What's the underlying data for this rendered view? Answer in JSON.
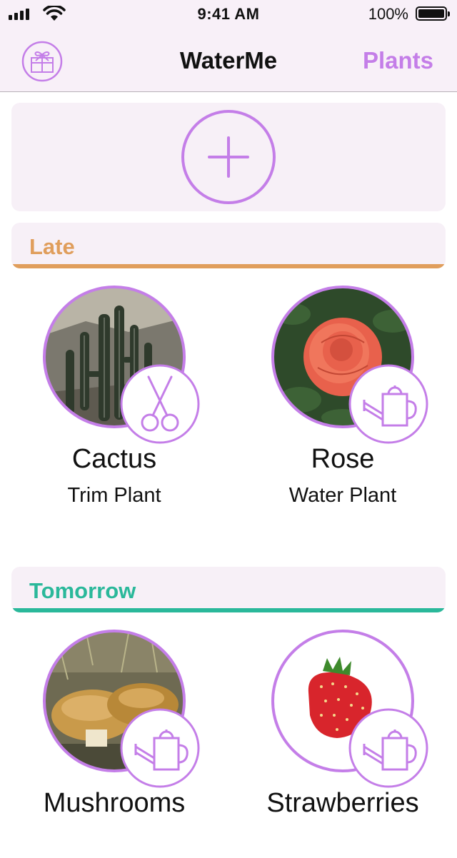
{
  "status": {
    "time": "9:41 AM",
    "battery": "100%"
  },
  "nav": {
    "title": "WaterMe",
    "right_button": "Plants",
    "left_icon": "gift-icon"
  },
  "add": {
    "icon": "plus-icon"
  },
  "colors": {
    "accent": "#c47ee8",
    "late": "#e09e5c",
    "tomorrow": "#2ab89a",
    "card_bg": "#f7f0f7"
  },
  "sections": [
    {
      "title": "Late",
      "plants": [
        {
          "name": "Cactus",
          "task": "Trim Plant",
          "badge_icon": "scissors-icon"
        },
        {
          "name": "Rose",
          "task": "Water Plant",
          "badge_icon": "watering-can-icon"
        }
      ]
    },
    {
      "title": "Tomorrow",
      "plants": [
        {
          "name": "Mushrooms",
          "task": "",
          "badge_icon": "watering-can-icon"
        },
        {
          "name": "Strawberries",
          "task": "",
          "badge_icon": "watering-can-icon"
        }
      ]
    }
  ]
}
